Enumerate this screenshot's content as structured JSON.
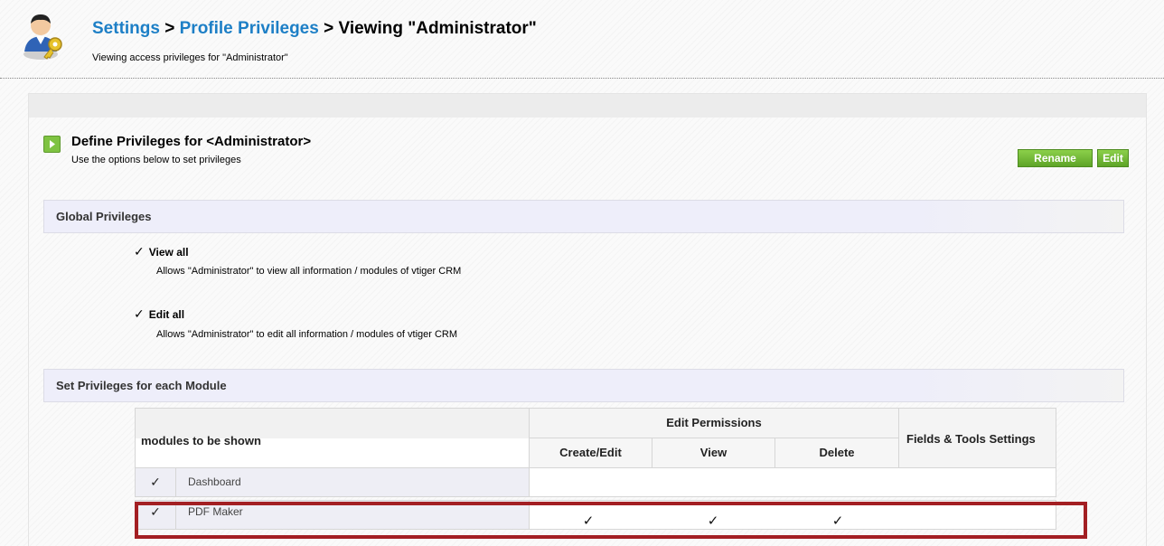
{
  "header": {
    "breadcrumb": [
      "Settings",
      "Profile Privileges",
      "Viewing \"Administrator\""
    ],
    "separator": ">",
    "subtitle": "Viewing access privileges for \"Administrator\""
  },
  "define": {
    "title": "Define Privileges for <Administrator>",
    "subtitle": "Use the options below to set privileges"
  },
  "buttons": {
    "rename": "Rename",
    "edit": "Edit"
  },
  "global_privileges": {
    "heading": "Global Privileges",
    "items": [
      {
        "check": "✓",
        "title": "View all",
        "desc": "Allows \"Administrator\" to view all information / modules of vtiger CRM"
      },
      {
        "check": "✓",
        "title": "Edit all",
        "desc": "Allows \"Administrator\" to edit all information / modules of vtiger CRM"
      }
    ]
  },
  "module_privileges": {
    "heading": "Set Privileges for each Module",
    "columns": {
      "modules": "modules to be shown",
      "edit_permissions": "Edit Permissions",
      "create_edit": "Create/Edit",
      "view": "View",
      "delete": "Delete",
      "fields_tools": "Fields & Tools Settings"
    },
    "rows": [
      {
        "check": "✓",
        "name": "Dashboard",
        "create_edit": "",
        "view": "",
        "delete": ""
      },
      {
        "check": "✓",
        "name": "PDF Maker",
        "create_edit": "✓",
        "view": "✓",
        "delete": "✓"
      }
    ]
  },
  "colors": {
    "link": "#1d7fc6",
    "button": "#6cb532",
    "highlight": "#a31f23"
  },
  "icons": [
    "admin-user-key-icon",
    "arrow-right-icon",
    "check-icon"
  ]
}
